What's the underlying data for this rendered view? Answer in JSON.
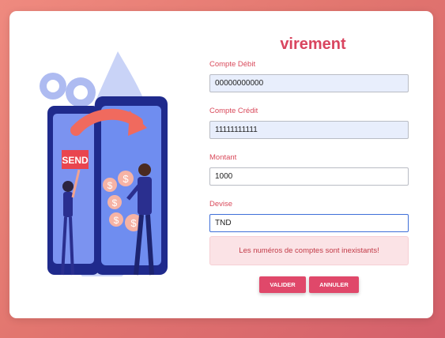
{
  "page": {
    "title": "virement"
  },
  "illustration": {
    "send_sign": "SEND"
  },
  "fields": {
    "compte_debit": {
      "label": "Compte Débit",
      "value": "00000000000"
    },
    "compte_credit": {
      "label": "Compte Crédit",
      "value": "11111111111"
    },
    "montant": {
      "label": "Montant",
      "value": "1000"
    },
    "devise": {
      "label": "Devise",
      "value": "TND"
    }
  },
  "alert": {
    "message": "Les numéros de comptes sont inexistants!"
  },
  "buttons": {
    "valider": "VALIDER",
    "annuler": "ANNULER"
  },
  "colors": {
    "accent": "#d9455f",
    "button": "#e0486a",
    "alert_bg": "#fbe3e6",
    "alert_text": "#c23a47",
    "phone": "#1f2a8c",
    "screen": "#6f8df0"
  }
}
